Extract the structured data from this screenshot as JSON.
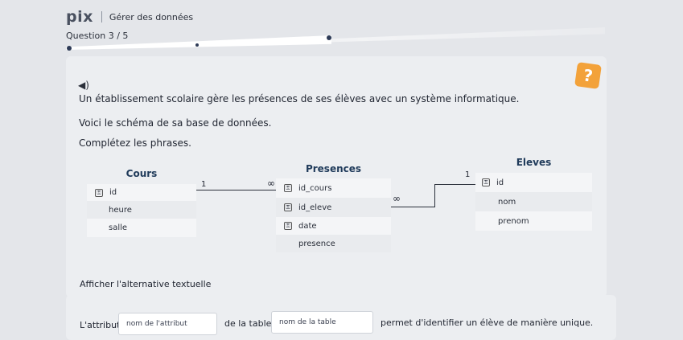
{
  "header": {
    "logo": "pix",
    "title": "Gérer des données"
  },
  "question": {
    "counter": "Question 3 / 5",
    "progress_fraction": 0.6
  },
  "help": {
    "icon": "question-icon",
    "label": "?"
  },
  "content": {
    "speaker": "speaker-icon",
    "paragraphs": [
      "Un établissement scolaire gère les présences de ses élèves avec un système informatique.",
      "Voici le schéma de sa base de données.",
      "Complétez les phrases."
    ]
  },
  "schema": {
    "cours": {
      "title": "Cours",
      "fields": [
        "id",
        "heure",
        "salle"
      ],
      "key_field": "id"
    },
    "presences": {
      "title": "Presences",
      "fields": [
        "id_cours",
        "id_eleve",
        "date",
        "presence"
      ]
    },
    "eleves": {
      "title": "Eleves",
      "fields": [
        "id",
        "nom",
        "prenom"
      ]
    },
    "relations": {
      "cours_side": "1",
      "presences_left": "∞",
      "presences_right": "∞",
      "eleves_side": "1"
    },
    "key_glyph": "🔑"
  },
  "alt_text_link": "Afficher l'alternative textuelle",
  "answer": {
    "prefix": "L'attribut",
    "field1_placeholder": "nom de l'attribut",
    "middle": "de la table",
    "field2_placeholder": "nom de la table",
    "suffix": "permet d'identifier un élève de manière unique."
  }
}
